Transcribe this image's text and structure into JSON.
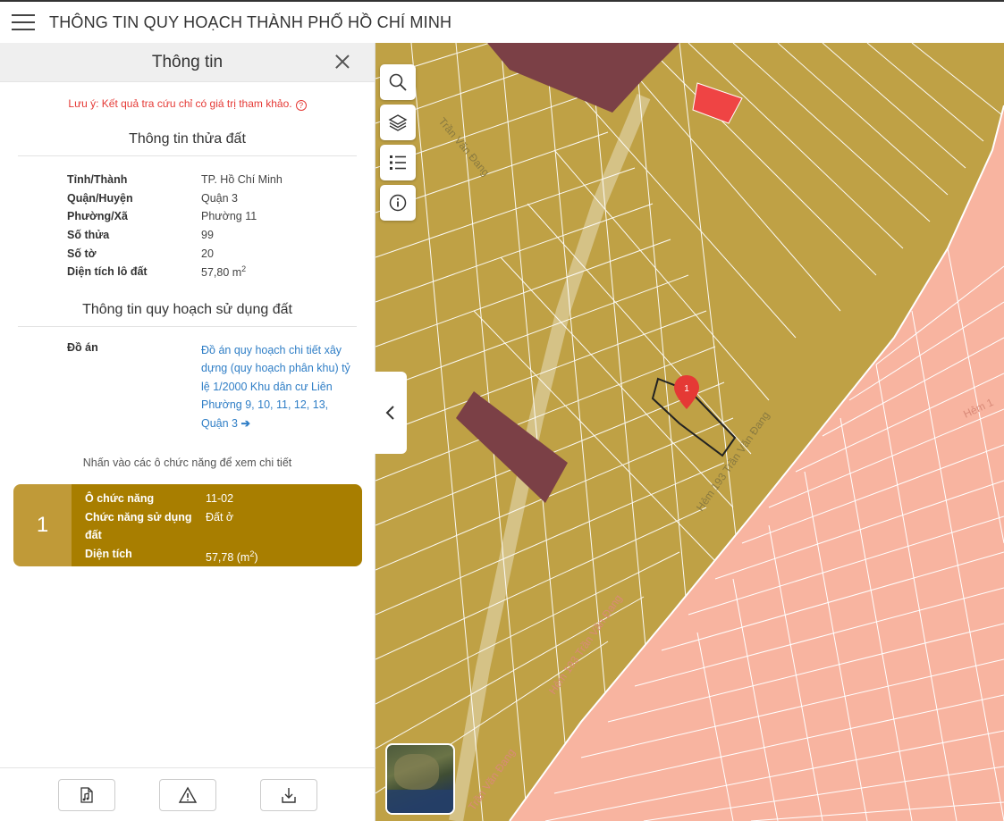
{
  "app": {
    "title": "THÔNG TIN QUY HOẠCH THÀNH PHỐ HỒ CHÍ MINH",
    "menu_icon": "hamburger-menu-icon"
  },
  "panel": {
    "title": "Thông tin",
    "note": "Lưu ý: Kết quả tra cứu chỉ có giá trị tham khảo.",
    "note_help": "?",
    "land_section_title": "Thông tin thửa đất",
    "land_info": [
      {
        "label": "Tỉnh/Thành",
        "value": "TP. Hồ Chí Minh"
      },
      {
        "label": "Quận/Huyện",
        "value": "Quận 3"
      },
      {
        "label": "Phường/Xã",
        "value": "Phường 11"
      },
      {
        "label": "Số thửa",
        "value": "99"
      },
      {
        "label": "Số tờ",
        "value": "20"
      }
    ],
    "area_label": "Diện tích lô đất",
    "area_value": "57,80 m",
    "area_unit_exp": "2",
    "plan_section_title": "Thông tin quy hoạch sử dụng đất",
    "plan_label": "Đồ án",
    "plan_link": "Đồ án quy hoạch chi tiết xây dựng (quy hoạch phân khu) tỷ lệ 1/2000 Khu dân cư Liên Phường 9, 10, 11, 12, 13, Quận 3",
    "plan_link_arrow": "➔",
    "hint": "Nhấn vào các ô chức năng để xem chi tiết"
  },
  "zone_card": {
    "number": "1",
    "rows": [
      {
        "label": "Ô chức năng",
        "value": "11-02"
      },
      {
        "label": "Chức năng sử dụng đất",
        "value": "Đất ở"
      }
    ],
    "area_label": "Diện tích",
    "area_value_prefix": "57,78 (m",
    "area_exp": "2",
    "area_value_suffix": ")",
    "colors": {
      "number_bg": "#c09a38",
      "body_bg": "#a87e00"
    }
  },
  "footer": {
    "buttons": [
      {
        "name": "document-music-icon"
      },
      {
        "name": "warning-icon"
      },
      {
        "name": "download-icon"
      }
    ]
  },
  "map": {
    "marker_label": "1",
    "street_labels": [
      "Trần Văn Đang",
      "Hẻm 193 Trần Văn Đang",
      "Hẻm 193 Trần Văn Đang",
      "Trần Văn Đang",
      "Hẻm 1"
    ],
    "colors": {
      "residential": "#bfa145",
      "residential_line": "#ffffff",
      "mixed_use": "#f8b4a0",
      "public": "#7b4046",
      "highlight": "#ef4444",
      "selected_outline": "#222222",
      "marker": "#e53935"
    },
    "tools": [
      "search-icon",
      "layers-icon",
      "list-icon",
      "info-icon"
    ],
    "collapse_icon": "chevron-left-icon"
  }
}
